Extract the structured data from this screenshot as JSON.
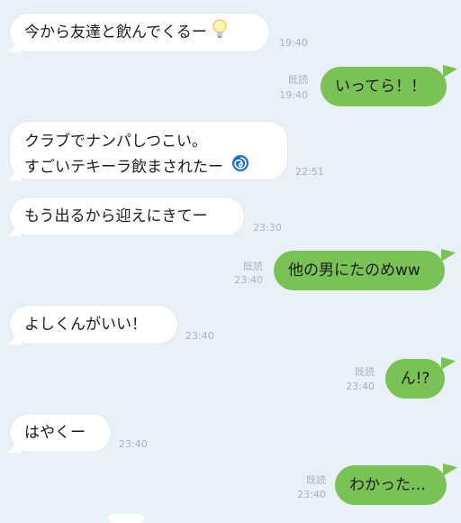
{
  "messages": [
    {
      "dir": "in",
      "text": "今から友達と飲んでくるー",
      "icon": "lightbulb-emoji",
      "time": "19:40"
    },
    {
      "dir": "out",
      "text": "いってら！！",
      "read": "既読",
      "time": "19:40"
    },
    {
      "dir": "in",
      "lines": [
        "クラブでナンパしつこい。",
        "すごいテキーラ飲まされたー"
      ],
      "icon": "cyclone-emoji",
      "time": "22:51"
    },
    {
      "dir": "in",
      "text": "もう出るから迎えにきてー",
      "time": "23:30"
    },
    {
      "dir": "out",
      "text": "他の男にたのめww",
      "read": "既読",
      "time": "23:40"
    },
    {
      "dir": "in",
      "text": "よしくんがいい！",
      "time": "23:40"
    },
    {
      "dir": "out",
      "text": "ん!?",
      "read": "既読",
      "time": "23:40"
    },
    {
      "dir": "in",
      "text": "はやくー",
      "time": "23:40"
    },
    {
      "dir": "out",
      "text": "わかった…",
      "read": "既読",
      "time": "23:40"
    }
  ],
  "colors": {
    "background": "#e8f0f8",
    "sent_bubble": "#7bc256",
    "received_bubble": "#ffffff",
    "meta_text": "#a9b4bf"
  }
}
